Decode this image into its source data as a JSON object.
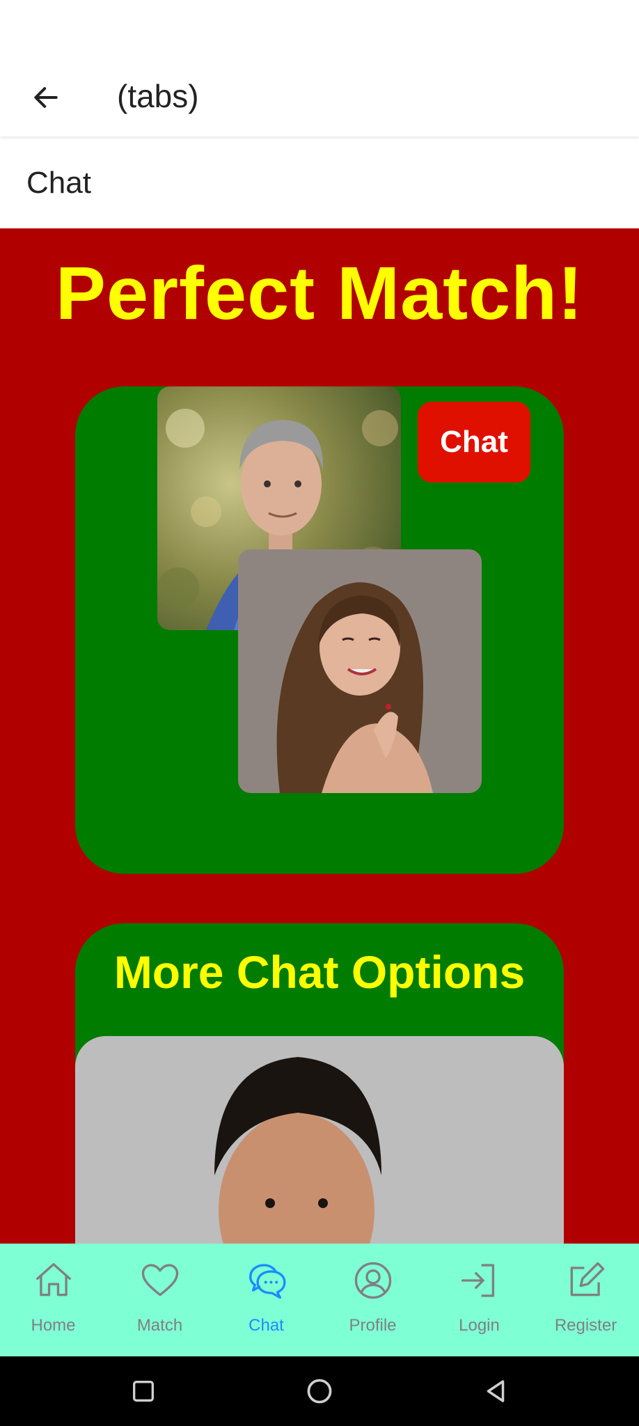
{
  "appbar": {
    "title": "(tabs)",
    "back_icon": "arrow-left-icon"
  },
  "page": {
    "title": "Chat"
  },
  "hero": {
    "title": "Perfect Match!"
  },
  "match_card": {
    "chat_button": "Chat"
  },
  "options": {
    "title": "More Chat Options"
  },
  "tabs": [
    {
      "label": "Home",
      "icon": "home-icon",
      "active": false
    },
    {
      "label": "Match",
      "icon": "heart-icon",
      "active": false
    },
    {
      "label": "Chat",
      "icon": "chat-bubbles-icon",
      "active": true
    },
    {
      "label": "Profile",
      "icon": "profile-icon",
      "active": false
    },
    {
      "label": "Login",
      "icon": "login-icon",
      "active": false
    },
    {
      "label": "Register",
      "icon": "edit-icon",
      "active": false
    }
  ],
  "colors": {
    "background": "#b00000",
    "card": "#007c00",
    "title": "#ffff00",
    "chat_button": "#e01000",
    "tabbar": "#7fffd4",
    "tab_active": "#1a8cff",
    "tab_inactive": "#808080"
  },
  "system_nav": {
    "icons": [
      "recents-square-icon",
      "home-circle-icon",
      "back-triangle-icon"
    ]
  }
}
